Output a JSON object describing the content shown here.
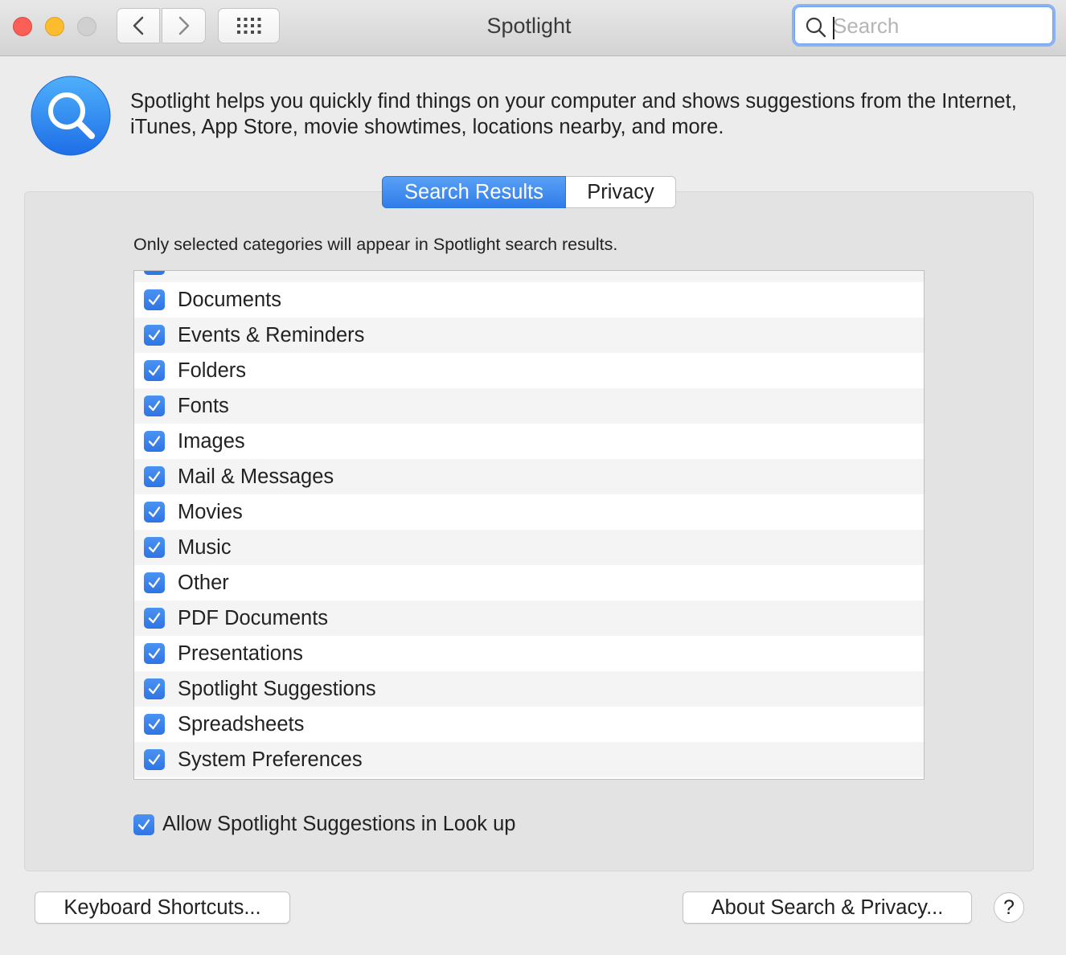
{
  "window": {
    "title": "Spotlight",
    "search": {
      "placeholder": "Search",
      "value": ""
    }
  },
  "header": {
    "description": "Spotlight helps you quickly find things on your computer and shows suggestions from the Internet, iTunes, App Store, movie showtimes, locations nearby, and more."
  },
  "tabs": [
    {
      "label": "Search Results",
      "active": true
    },
    {
      "label": "Privacy",
      "active": false
    }
  ],
  "hint": "Only selected categories will appear in Spotlight search results.",
  "categories": [
    {
      "label": "Documents",
      "checked": true
    },
    {
      "label": "Events & Reminders",
      "checked": true
    },
    {
      "label": "Folders",
      "checked": true
    },
    {
      "label": "Fonts",
      "checked": true
    },
    {
      "label": "Images",
      "checked": true
    },
    {
      "label": "Mail & Messages",
      "checked": true
    },
    {
      "label": "Movies",
      "checked": true
    },
    {
      "label": "Music",
      "checked": true
    },
    {
      "label": "Other",
      "checked": true
    },
    {
      "label": "PDF Documents",
      "checked": true
    },
    {
      "label": "Presentations",
      "checked": true
    },
    {
      "label": "Spotlight Suggestions",
      "checked": true
    },
    {
      "label": "Spreadsheets",
      "checked": true
    },
    {
      "label": "System Preferences",
      "checked": true
    }
  ],
  "allow_lookup": {
    "label": "Allow Spotlight Suggestions in Look up",
    "checked": true
  },
  "buttons": {
    "keyboard_shortcuts": "Keyboard Shortcuts...",
    "about": "About Search & Privacy...",
    "help": "?"
  },
  "colors": {
    "accent": "#3b82f0",
    "close": "#fc5f57",
    "minimize": "#fdbc2e"
  },
  "icons": [
    "back-icon",
    "forward-icon",
    "grid-icon",
    "search-icon",
    "spotlight-app-icon",
    "checkmark-icon"
  ]
}
